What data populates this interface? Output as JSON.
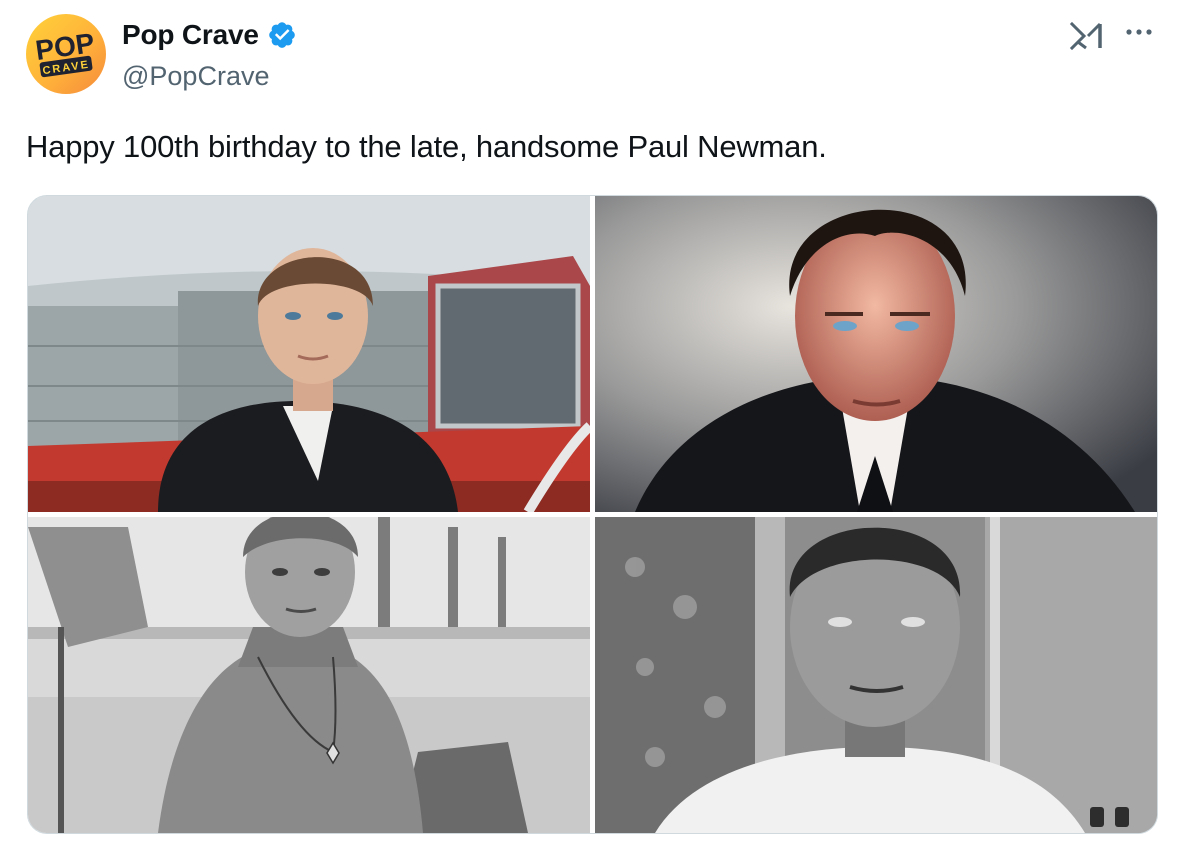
{
  "tweet": {
    "author": {
      "display_name": "Pop Crave",
      "handle": "@PopCrave",
      "verified": true,
      "avatar_text_top": "POP",
      "avatar_text_bottom": "CRAVE"
    },
    "text": "Happy 100th birthday to the late, handsome Paul Newman.",
    "icons": {
      "grok": "grok-icon",
      "more": "more-icon",
      "verified": "verified-badge-icon"
    },
    "media": [
      {
        "kind": "photo",
        "style": "color"
      },
      {
        "kind": "photo",
        "style": "color"
      },
      {
        "kind": "photo",
        "style": "black-and-white"
      },
      {
        "kind": "photo",
        "style": "black-and-white"
      }
    ]
  },
  "colors": {
    "verified": "#1d9bf0",
    "secondary_text": "#536471",
    "border": "#cfd9de"
  }
}
